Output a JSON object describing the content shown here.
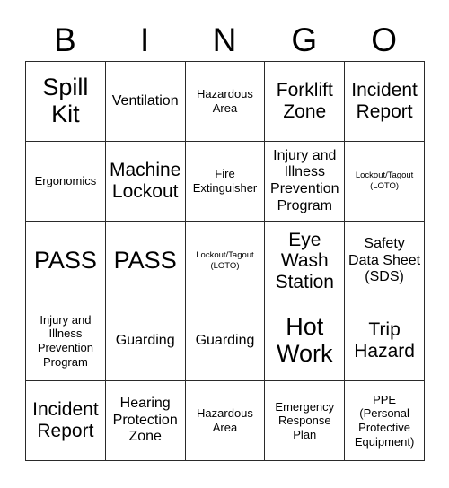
{
  "card": {
    "header_letters": [
      "B",
      "I",
      "N",
      "G",
      "O"
    ],
    "rows": [
      [
        {
          "text": "Spill Kit",
          "size": "xl"
        },
        {
          "text": "Ventilation",
          "size": "md"
        },
        {
          "text": "Hazardous Area",
          "size": "sm"
        },
        {
          "text": "Forklift Zone",
          "size": "lg"
        },
        {
          "text": "Incident Report",
          "size": "lg"
        }
      ],
      [
        {
          "text": "Ergonomics",
          "size": "sm"
        },
        {
          "text": "Machine Lockout",
          "size": "lg"
        },
        {
          "text": "Fire Extinguisher",
          "size": "sm"
        },
        {
          "text": "Injury and Illness Prevention Program",
          "size": "md"
        },
        {
          "text": "Lockout/Tagout (LOTO)",
          "size": "xxs"
        }
      ],
      [
        {
          "text": "PASS",
          "size": "xl"
        },
        {
          "text": "PASS",
          "size": "xl"
        },
        {
          "text": "Lockout/Tagout (LOTO)",
          "size": "xxs"
        },
        {
          "text": "Eye Wash Station",
          "size": "lg"
        },
        {
          "text": "Safety Data Sheet (SDS)",
          "size": "md"
        }
      ],
      [
        {
          "text": "Injury and Illness Prevention Program",
          "size": "sm"
        },
        {
          "text": "Guarding",
          "size": "md"
        },
        {
          "text": "Guarding",
          "size": "md"
        },
        {
          "text": "Hot Work",
          "size": "xl"
        },
        {
          "text": "Trip Hazard",
          "size": "lg"
        }
      ],
      [
        {
          "text": "Incident Report",
          "size": "lg"
        },
        {
          "text": "Hearing Protection Zone",
          "size": "md"
        },
        {
          "text": "Hazardous Area",
          "size": "sm"
        },
        {
          "text": "Emergency Response Plan",
          "size": "sm"
        },
        {
          "text": "PPE (Personal Protective Equipment)",
          "size": "sm"
        }
      ]
    ]
  },
  "colors": {
    "border": "#2a2a2a",
    "text": "#000000",
    "background": "#ffffff"
  }
}
